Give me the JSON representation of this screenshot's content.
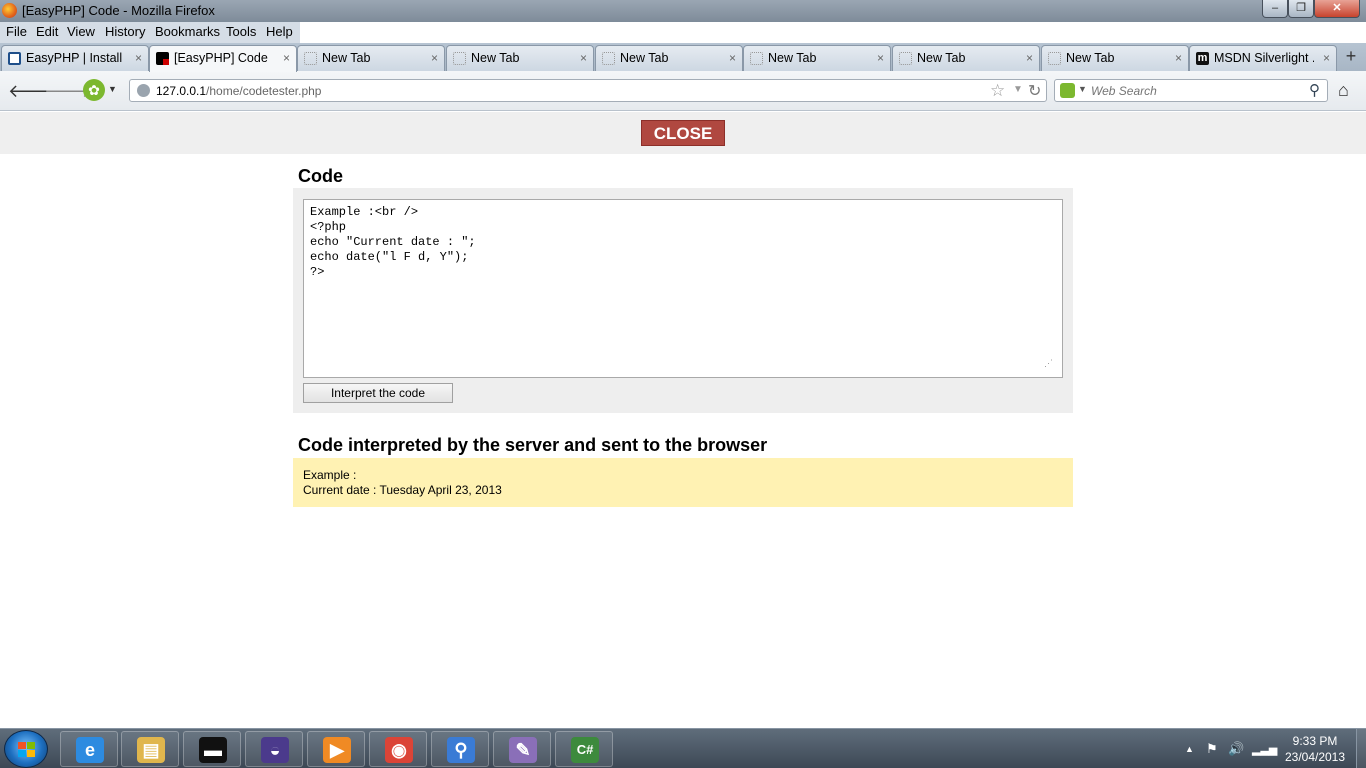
{
  "window": {
    "title": "[EasyPHP] Code - Mozilla Firefox",
    "minimize": "‒",
    "maximize": "❐",
    "close": "✕"
  },
  "menu": [
    "File",
    "Edit",
    "View",
    "History",
    "Bookmarks",
    "Tools",
    "Help"
  ],
  "tabs": [
    {
      "label": "EasyPHP | Install a...",
      "icon": "easyphp-icon",
      "active": false
    },
    {
      "label": "[EasyPHP] Code",
      "icon": "code-favicon-icon",
      "active": true
    },
    {
      "label": "New Tab",
      "icon": "blank-page-icon",
      "active": false
    },
    {
      "label": "New Tab",
      "icon": "blank-page-icon",
      "active": false
    },
    {
      "label": "New Tab",
      "icon": "blank-page-icon",
      "active": false
    },
    {
      "label": "New Tab",
      "icon": "blank-page-icon",
      "active": false
    },
    {
      "label": "New Tab",
      "icon": "blank-page-icon",
      "active": false
    },
    {
      "label": "New Tab",
      "icon": "blank-page-icon",
      "active": false
    },
    {
      "label": "MSDN Silverlight ...",
      "icon": "msdn-icon",
      "active": false
    }
  ],
  "tab_close_glyph": "×",
  "new_tab_glyph": "+",
  "nav": {
    "back_glyph": "🡐",
    "forward_glyph": "🡒",
    "url_host": "127.0.0.1",
    "url_path": "/home/codetester.php",
    "search_placeholder": "Web Search",
    "star_glyph": "☆",
    "drop_glyph": "▼",
    "reload_glyph": "↻",
    "search_glyph": "⚲",
    "home_glyph": "⌂",
    "ext_glyph": "✿"
  },
  "page": {
    "close_label": "CLOSE",
    "code_heading": "Code",
    "code_text": "Example :<br />\n<?php\necho \"Current date : \";\necho date(\"l F d, Y\");\n?>",
    "interpret_label": "Interpret the code",
    "output_heading": "Code interpreted by the server and sent to the browser",
    "output_line1": "Example :",
    "output_line2": "Current date : Tuesday April 23, 2013",
    "resize_glyph": "⋰"
  },
  "taskbar": {
    "apps": [
      {
        "name": "internet-explorer-icon",
        "glyph": "e",
        "color": "#2d8be0"
      },
      {
        "name": "file-explorer-icon",
        "glyph": "▤",
        "color": "#e0b64d"
      },
      {
        "name": "terminal-icon",
        "glyph": "▬",
        "color": "#111111"
      },
      {
        "name": "eclipse-icon",
        "glyph": "◒",
        "color": "#4b3a8c"
      },
      {
        "name": "media-player-icon",
        "glyph": "▶",
        "color": "#f08a24"
      },
      {
        "name": "chrome-icon",
        "glyph": "◉",
        "color": "#db4437"
      },
      {
        "name": "search-magnifier-icon",
        "glyph": "⚲",
        "color": "#3a7bd5"
      },
      {
        "name": "paint-icon",
        "glyph": "✎",
        "color": "#8a6fb8"
      },
      {
        "name": "csharp-icon",
        "glyph": "C#",
        "color": "#3d8a3d"
      }
    ],
    "tray_up": "▲",
    "tray_flag": "⚑",
    "tray_volume": "🔊",
    "tray_signal": "▂▃▅",
    "time": "9:33 PM",
    "date": "23/04/2013"
  }
}
